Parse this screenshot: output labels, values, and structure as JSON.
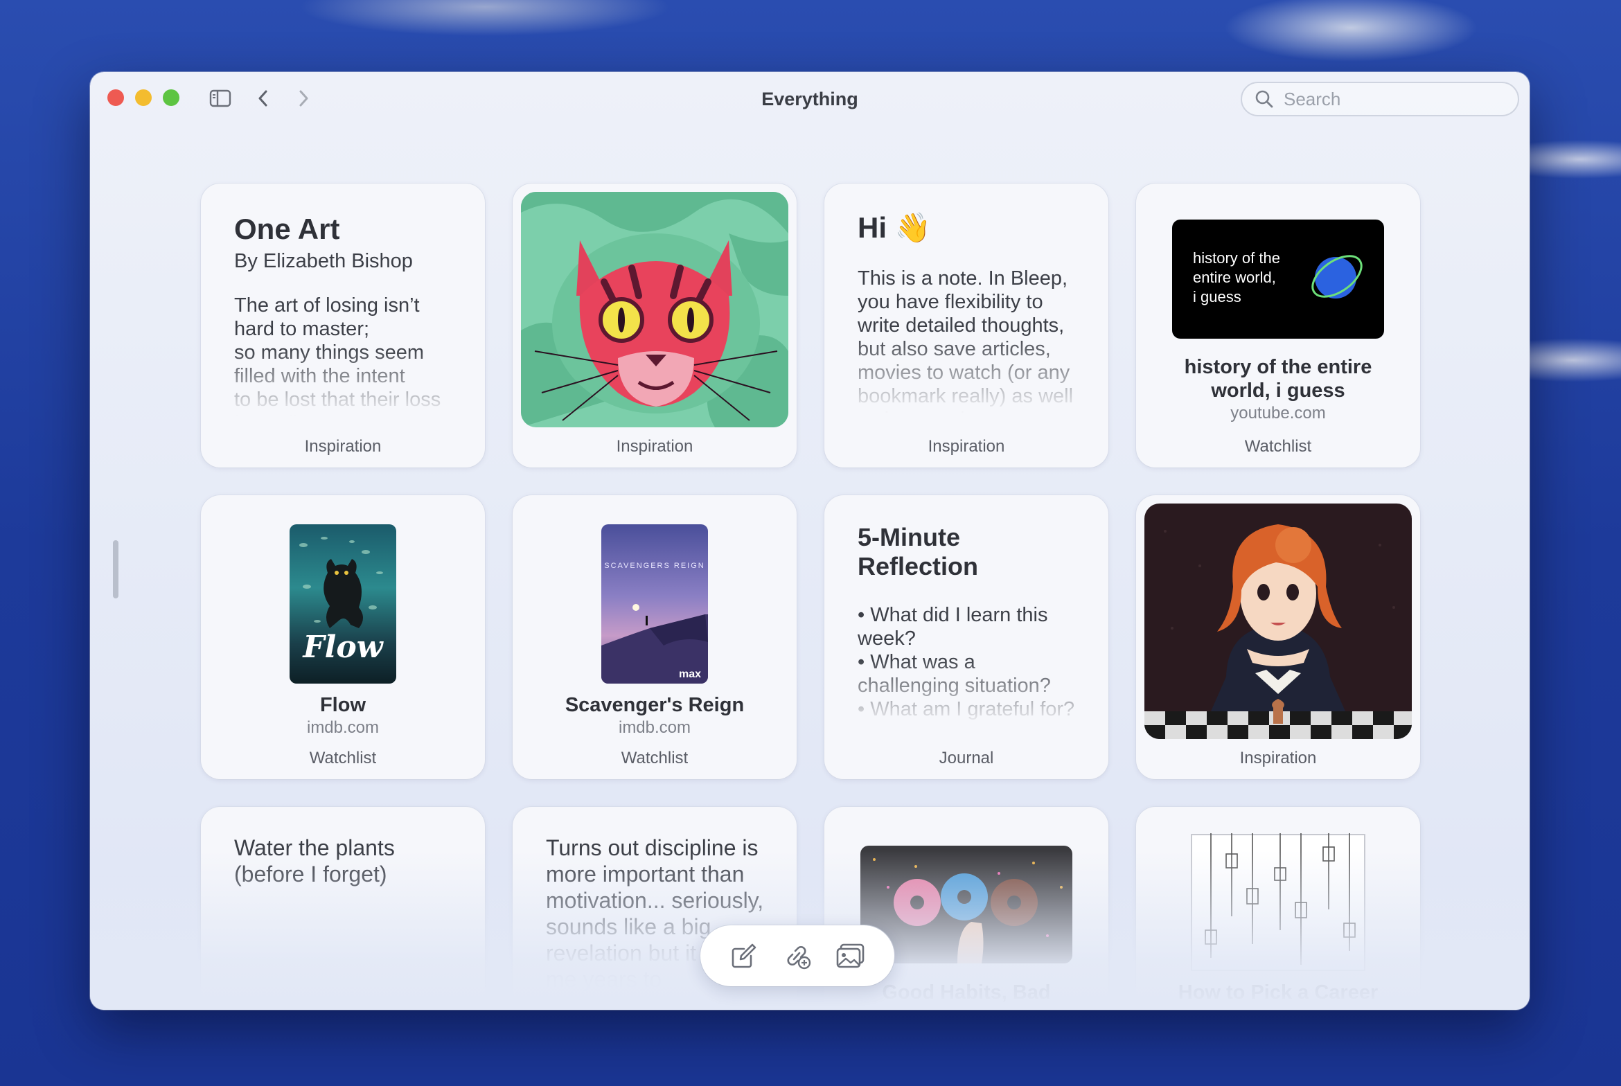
{
  "window": {
    "title": "Everything",
    "search_placeholder": "Search",
    "sidebar_icon": "sidebar-toggle-icon",
    "back_icon": "chevron-left-icon",
    "forward_icon": "chevron-right-icon"
  },
  "cards": {
    "one_art": {
      "title": "One Art",
      "subtitle": "By Elizabeth Bishop",
      "body": "The art of losing isn’t hard to master;\nso many things seem filled with the intent\nto be lost that their loss\nis no disaster.",
      "tag": "Inspiration"
    },
    "cat_image": {
      "tag": "Inspiration"
    },
    "hi_note": {
      "title": "Hi 👋",
      "body": "This is a note. In Bleep, you have flexibility to write detailed thoughts, but also save articles, movies to watch (or any bookmark really) as well as images that you can",
      "tag": "Inspiration"
    },
    "history_video": {
      "thumb_text": "history of the\nentire world,\ni guess",
      "title": "history of the entire world, i guess",
      "source": "youtube.com",
      "tag": "Watchlist"
    },
    "flow": {
      "poster_text": "Flow",
      "title": "Flow",
      "source": "imdb.com",
      "tag": "Watchlist"
    },
    "scavengers": {
      "poster_header": "SCAVENGERS REIGN",
      "poster_brand": "max",
      "title": "Scavenger's Reign",
      "source": "imdb.com",
      "tag": "Watchlist"
    },
    "reflection": {
      "title": "5-Minute Reflection",
      "body": "• What did I learn this week?\n• What was a challenging situation?\n• What am I grateful for?",
      "tag": "Journal"
    },
    "queens_image": {
      "tag": "Inspiration"
    },
    "water_plants": {
      "body": "Water the plants (before I forget)"
    },
    "discipline": {
      "body": "Turns out discipline is more important than motivation... seriously, sounds like a big revelation but it took me years to"
    },
    "good_habits": {
      "title": "Good Habits, Bad"
    },
    "career": {
      "title": "How to Pick a Career"
    }
  },
  "toolbar": {
    "new_note_icon": "compose-icon",
    "add_link_icon": "add-link-icon",
    "add_image_icon": "add-image-icon"
  }
}
